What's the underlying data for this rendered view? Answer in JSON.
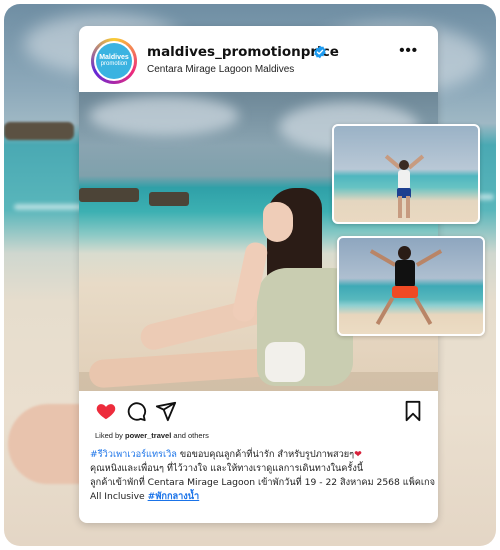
{
  "post": {
    "username": "maldives_promotionprice",
    "location": "Centara Mirage Lagoon Maldives",
    "avatar": {
      "line1": "Maldives",
      "line2": "promotion"
    },
    "more_icon": "more-horizontal-icon",
    "liked_by_prefix": "Liked by ",
    "liked_by_user": "power_travel",
    "liked_by_suffix": " and others",
    "caption": {
      "hashtag1": "#รีวิวเพาเวอร์แทรเวิล",
      "line1_text": " ขอขอบคุณลูกค้าที่น่ารัก สำหรับรูปภาพสวยๆ",
      "line1_emoji": "❤",
      "line2": "คุณหนิงและเพื่อนๆ ที่ไว้วางใจ และให้ทางเราดูแลการเดินทางในครั้งนี้",
      "line3": "ลูกค้าเข้าพักที่ Centara Mirage Lagoon เข้าพักวันที่ 19 - 22 สิงหาคม 2568 แพ็คเกจ",
      "line4_text": "All Inclusive ",
      "hashtag2": "#พักกลางน้ำ"
    }
  },
  "colors": {
    "like_heart": "#ed2c3c",
    "hashtag": "#1a73e8",
    "verified_badge": "#1d9bf0"
  },
  "icons": [
    "heart-filled-icon",
    "comment-icon",
    "share-icon",
    "bookmark-icon",
    "verified-badge-icon"
  ]
}
